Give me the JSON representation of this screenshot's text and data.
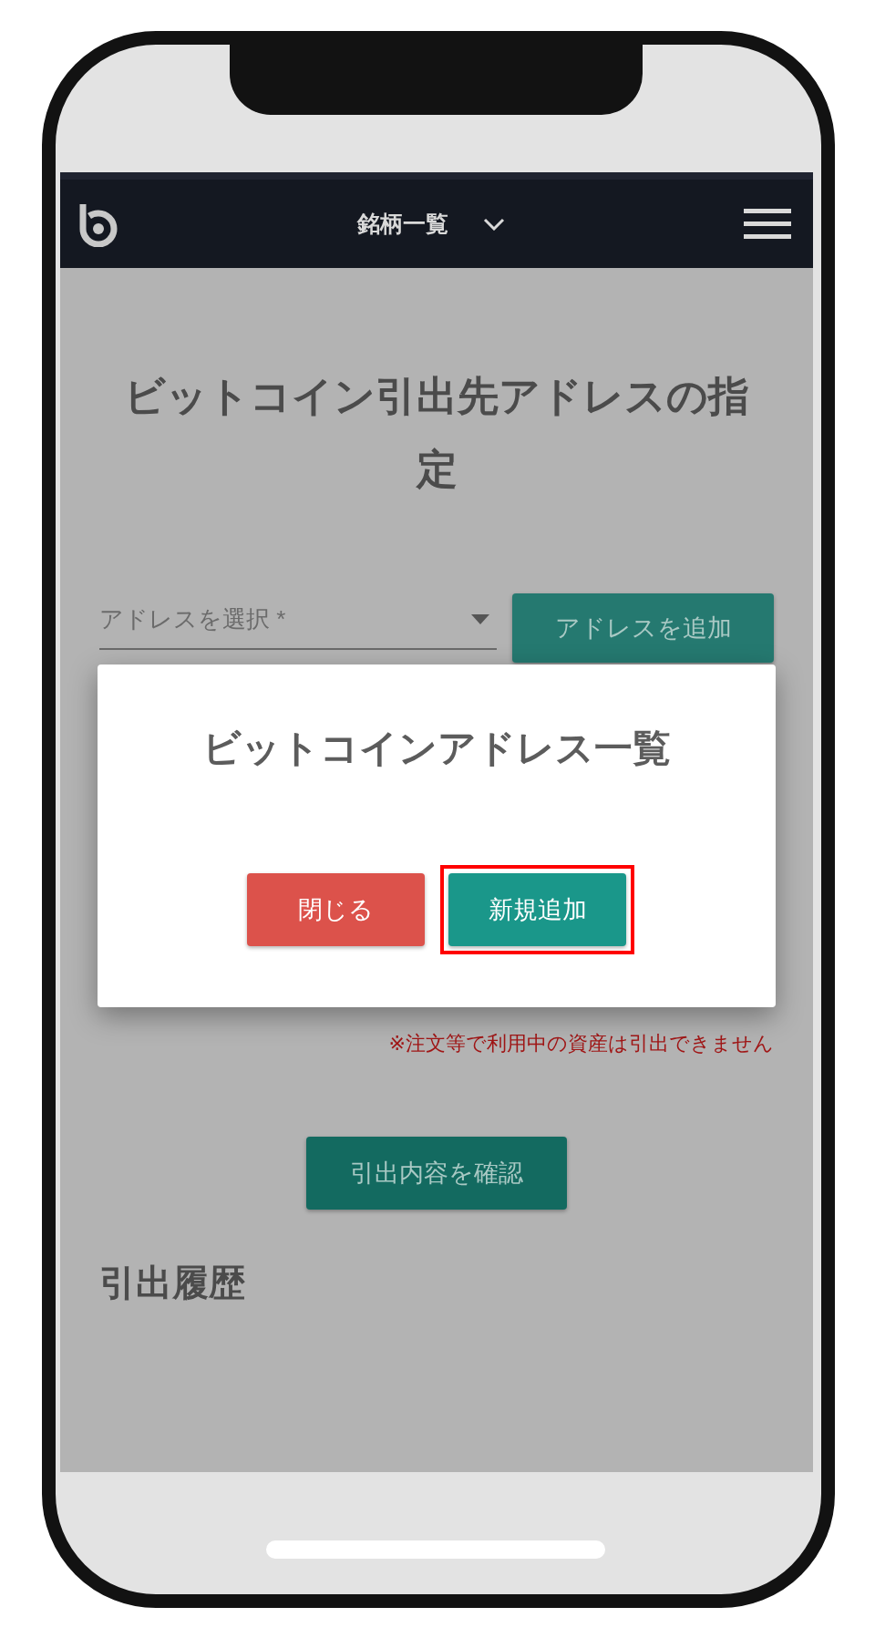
{
  "header": {
    "menu_label": "銘柄一覧"
  },
  "page": {
    "title": "ビットコイン引出先アドレスの指定",
    "address_select": {
      "placeholder": "アドレスを選択 *"
    },
    "add_button": "アドレスを追加",
    "note": "※注文等で利用中の資産は引出できません",
    "confirm_button": "引出内容を確認",
    "history_heading": "引出履歴"
  },
  "dialog": {
    "title": "ビットコインアドレス一覧",
    "buttons": [
      {
        "label": "閉じる",
        "kind": "cancel",
        "highlighted": false
      },
      {
        "label": "新規追加",
        "kind": "primary",
        "highlighted": true
      }
    ]
  }
}
